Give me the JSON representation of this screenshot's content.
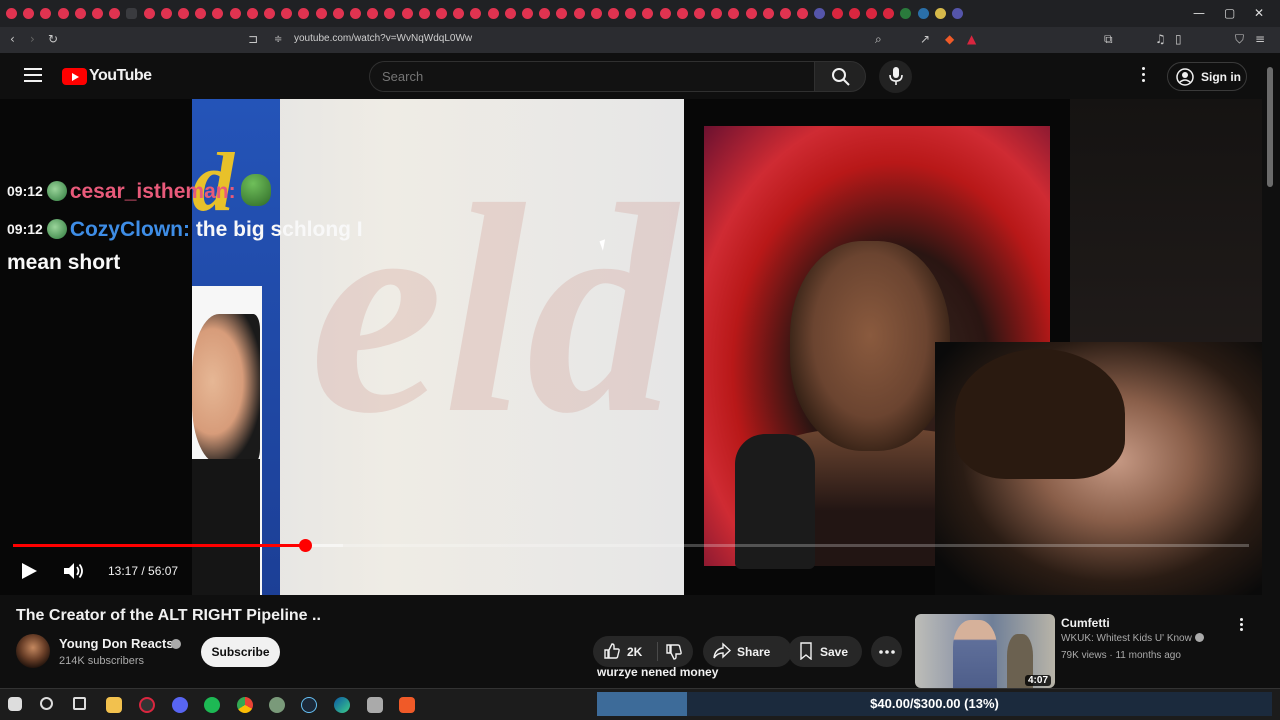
{
  "browser": {
    "url": "youtube.com/watch?v=WvNqWdqL0Ww",
    "tab_count_icons": 56
  },
  "header": {
    "logo_text": "YouTube",
    "search_placeholder": "Search",
    "signin_label": "Sign in"
  },
  "overlay_chat": {
    "line1": {
      "time": "09:12",
      "name": "cesar_istheman:"
    },
    "line2": {
      "time": "09:12",
      "name": "CozyClown:",
      "message": "the big schlong I"
    },
    "line3": "mean short"
  },
  "player": {
    "time_label": "13:17 / 56:07",
    "progress": 0.2366,
    "buffered": 0.2668
  },
  "video": {
    "title": "The Creator of the ALT RIGHT Pipeline ..",
    "channel_name": "Young Don Reacts",
    "subscribers": "214K subscribers",
    "subscribe_label": "Subscribe",
    "like_count": "2K",
    "share_label": "Share",
    "save_label": "Save",
    "caption_line": "wurzye nened money"
  },
  "recommended": {
    "title": "Cumfetti",
    "channel": "WKUK: Whitest Kids U' Know",
    "meta": "79K views · 11 months ago",
    "duration": "4:07"
  },
  "donation": {
    "label": "$40.00/$300.00 (13%)",
    "progress": 0.1333
  },
  "colors": {
    "accent": "#ff0000",
    "chat_name1": "#e85a7a",
    "chat_name2": "#3e8de6"
  }
}
